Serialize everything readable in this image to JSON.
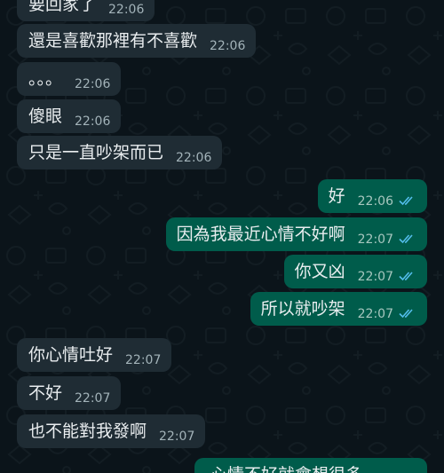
{
  "messages": [
    {
      "side": "in",
      "text": "要回家了",
      "time": "22:06"
    },
    {
      "side": "in",
      "text": "還是喜歡那裡有不喜歡",
      "time": "22:06"
    },
    {
      "side": "in",
      "text": "。。。",
      "time": "22:06"
    },
    {
      "side": "in",
      "text": "傻眼",
      "time": "22:06"
    },
    {
      "side": "in",
      "text": "只是一直吵架而已",
      "time": "22:06"
    },
    {
      "side": "out",
      "text": "好",
      "time": "22:06"
    },
    {
      "side": "out",
      "text": "因為我最近心情不好啊",
      "time": "22:07"
    },
    {
      "side": "out",
      "text": "你又凶",
      "time": "22:07"
    },
    {
      "side": "out",
      "text": "所以就吵架",
      "time": "22:07"
    },
    {
      "side": "in",
      "text": "你心情吐好",
      "time": "22:07"
    },
    {
      "side": "in",
      "text": "不好",
      "time": "22:07"
    },
    {
      "side": "in",
      "text": "也不能對我發啊",
      "time": "22:07"
    },
    {
      "side": "out",
      "text": "心情不好就會想很多",
      "time": ""
    }
  ],
  "colors": {
    "background": "#0b141a",
    "incoming_bubble": "#1f2c34",
    "outgoing_bubble": "#005c4b",
    "read_ticks": "#53bdeb"
  },
  "icons": {
    "read_receipt": "double-check-icon"
  }
}
